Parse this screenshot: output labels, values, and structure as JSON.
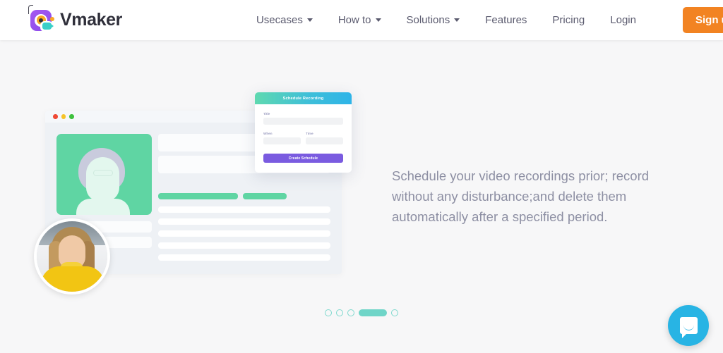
{
  "brand": {
    "name": "Vmaker",
    "logo_icon": "vmaker-camera-logo-icon",
    "colors": {
      "purple": "#8b4bea",
      "orange": "#f9a826",
      "teal": "#39cfc8"
    }
  },
  "nav": {
    "items": [
      {
        "label": "Usecases",
        "has_dropdown": true
      },
      {
        "label": "How to",
        "has_dropdown": true
      },
      {
        "label": "Solutions",
        "has_dropdown": true
      },
      {
        "label": "Features",
        "has_dropdown": false
      },
      {
        "label": "Pricing",
        "has_dropdown": false
      },
      {
        "label": "Login",
        "has_dropdown": false
      }
    ],
    "cta": {
      "label": "Sign up Now",
      "color": "#f28322"
    }
  },
  "hero": {
    "description": "Schedule your video recordings prior; record without any disturbance;and delete them automatically after a specified period.",
    "mockup": {
      "window_controls": [
        "close-red",
        "minimize-yellow",
        "maximize-green"
      ],
      "video_panel_color": "#5fd5a3",
      "avatar_alt": "woman in yellow turtleneck"
    },
    "schedule_modal": {
      "title": "Schedule Recording",
      "header_gradient": [
        "#5fd9b0",
        "#2eb4e8"
      ],
      "fields": [
        {
          "label": "Title",
          "value": ""
        },
        {
          "label": "When",
          "value": ""
        },
        {
          "label": "Time",
          "value": ""
        }
      ],
      "submit_label": "Create Schedule",
      "submit_color": "#7a5be0"
    },
    "carousel": {
      "slides": 5,
      "active_index": 3,
      "active_color": "#6fd5c8"
    }
  },
  "chat": {
    "icon": "chat-bubble-icon",
    "color": "#28b4e4"
  }
}
